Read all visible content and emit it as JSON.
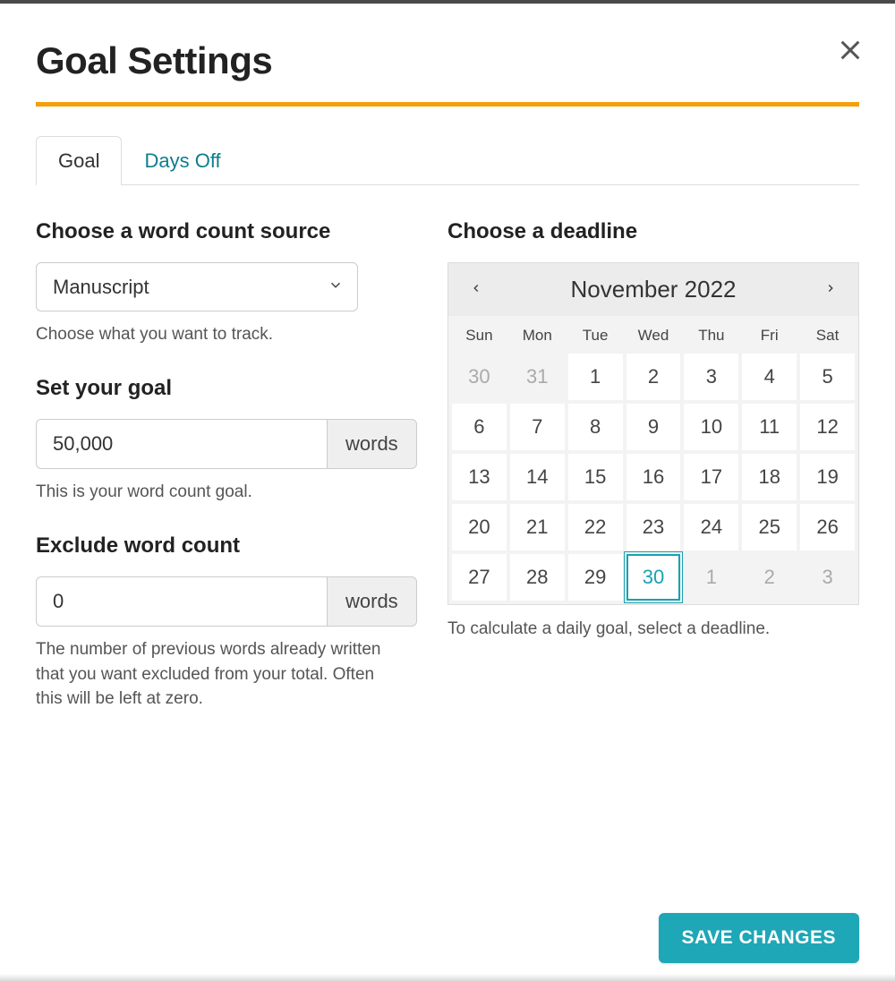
{
  "title": "Goal Settings",
  "tabs": {
    "goal": "Goal",
    "daysOff": "Days Off"
  },
  "source": {
    "heading": "Choose a word count source",
    "value": "Manuscript",
    "hint": "Choose what you want to track."
  },
  "goal": {
    "heading": "Set your goal",
    "value": "50,000",
    "unit": "words",
    "hint": "This is your word count goal."
  },
  "exclude": {
    "heading": "Exclude word count",
    "value": "0",
    "unit": "words",
    "hint": "The number of previous words already written that you want excluded from your total. Often this will be left at zero."
  },
  "deadline": {
    "heading": "Choose a deadline",
    "month": "November 2022",
    "dow": [
      "Sun",
      "Mon",
      "Tue",
      "Wed",
      "Thu",
      "Fri",
      "Sat"
    ],
    "days": [
      {
        "n": "30",
        "out": true
      },
      {
        "n": "31",
        "out": true
      },
      {
        "n": "1"
      },
      {
        "n": "2"
      },
      {
        "n": "3"
      },
      {
        "n": "4"
      },
      {
        "n": "5"
      },
      {
        "n": "6"
      },
      {
        "n": "7"
      },
      {
        "n": "8"
      },
      {
        "n": "9"
      },
      {
        "n": "10"
      },
      {
        "n": "11"
      },
      {
        "n": "12"
      },
      {
        "n": "13"
      },
      {
        "n": "14"
      },
      {
        "n": "15"
      },
      {
        "n": "16"
      },
      {
        "n": "17"
      },
      {
        "n": "18"
      },
      {
        "n": "19"
      },
      {
        "n": "20"
      },
      {
        "n": "21"
      },
      {
        "n": "22"
      },
      {
        "n": "23"
      },
      {
        "n": "24"
      },
      {
        "n": "25"
      },
      {
        "n": "26"
      },
      {
        "n": "27"
      },
      {
        "n": "28"
      },
      {
        "n": "29"
      },
      {
        "n": "30",
        "selected": true
      },
      {
        "n": "1",
        "out": true
      },
      {
        "n": "2",
        "out": true
      },
      {
        "n": "3",
        "out": true
      }
    ],
    "hint": "To calculate a daily goal, select a deadline."
  },
  "saveLabel": "SAVE CHANGES"
}
